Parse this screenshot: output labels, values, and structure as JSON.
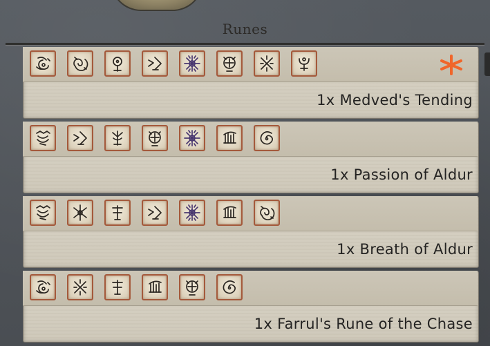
{
  "panel": {
    "title": "Runes",
    "entries": [
      {
        "label": "1x Medved's Tending",
        "has_marker": true,
        "runes": [
          "rune-swirl-a",
          "rune-spiral",
          "rune-eye",
          "rune-arrows",
          "rune-burst",
          "rune-orb",
          "rune-cross",
          "rune-hook"
        ]
      },
      {
        "label": "1x Passion of Aldur",
        "has_marker": false,
        "runes": [
          "rune-claw",
          "rune-arrows",
          "rune-tree",
          "rune-orb",
          "rune-burst",
          "rune-comb",
          "rune-swirl-b"
        ]
      },
      {
        "label": "1x Breath of Aldur",
        "has_marker": false,
        "runes": [
          "rune-claw",
          "rune-lattice",
          "rune-trident",
          "rune-arrows",
          "rune-burst",
          "rune-comb",
          "rune-spiral"
        ]
      },
      {
        "label": "1x Farrul's Rune of the Chase",
        "has_marker": false,
        "runes": [
          "rune-swirl-a",
          "rune-cross",
          "rune-trident",
          "rune-comb",
          "rune-orb",
          "rune-swirl-b"
        ]
      }
    ]
  },
  "colors": {
    "marker": "#f0662a",
    "rune_border": "#a4593b",
    "burst_ink": "#4a3870"
  }
}
